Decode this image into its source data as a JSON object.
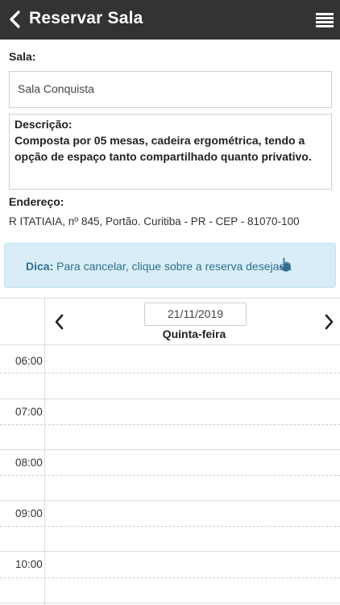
{
  "header": {
    "title": "Reservar Sala",
    "back_icon": "chevron-left-icon",
    "menu_icon": "hamburger-menu-icon"
  },
  "room": {
    "label": "Sala:",
    "value": "Sala Conquista"
  },
  "description": {
    "label": "Descrição:",
    "text": "Composta por 05 mesas, cadeira ergométrica, tendo a opção de espaço tanto compartilhado quanto privativo."
  },
  "address": {
    "label": "Endereço:",
    "text": "R ITATIAIA, nº 845, Portão. Curitiba - PR - CEP - 81070-100"
  },
  "tip": {
    "strong": "Dica:",
    "text": " Para cancelar, clique sobre a reserva desejada",
    "icon": "hand-pointer-icon"
  },
  "calendar": {
    "date": "21/11/2019",
    "weekday": "Quinta-feira",
    "hours": [
      "06:00",
      "07:00",
      "08:00",
      "09:00",
      "10:00"
    ]
  },
  "colors": {
    "header_bg": "#333333",
    "tip_bg": "#d9edf7",
    "tip_text": "#31708f"
  }
}
